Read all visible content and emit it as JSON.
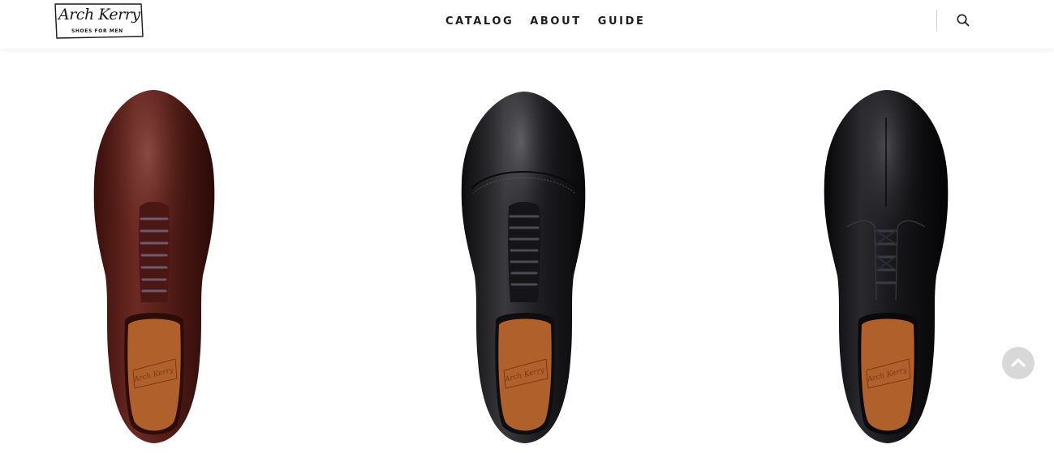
{
  "header": {
    "logo": {
      "script": "Arch Kerry",
      "tagline": "SHOES FOR MEN"
    },
    "nav": [
      {
        "label": "CATALOG"
      },
      {
        "label": "ABOUT"
      },
      {
        "label": "GUIDE"
      }
    ],
    "search_icon": "search-icon"
  },
  "products": [
    {
      "name": "burgundy-plain-toe-oxford",
      "color": "#5a1f1a"
    },
    {
      "name": "black-cap-toe-oxford",
      "color": "#1e1e20"
    },
    {
      "name": "black-split-toe-derby",
      "color": "#141416"
    }
  ],
  "scroll_top_icon": "chevron-up-icon",
  "colors": {
    "text": "#1d1d1d",
    "scroll_button": "#d8d8d8",
    "insole": "#b0602a"
  }
}
